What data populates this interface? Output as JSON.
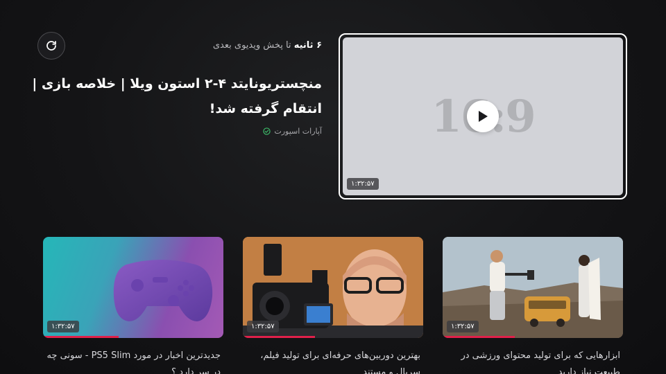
{
  "next": {
    "countdown_num": "۶ ثانیه",
    "countdown_rest": " تا پخش ویدیوی بعدی",
    "title": "منچستریونایتد ۴-۲ استون ویلا | خلاصه بازی | انتقام گرفته شد!",
    "channel": "آپارات اسپورت",
    "duration": "۱:۳۲:۵۷",
    "placeholder_text": "16:9"
  },
  "cards": [
    {
      "title": "ابزارهایی که برای تولید محتوای ورزشی در طبیعت نیاز دارید",
      "duration": "۱:۳۲:۵۷",
      "progress": 0.4
    },
    {
      "title": "بهترین دوربین‌های حرفه‌ای برای تولید فیلم، سریال و مستند",
      "duration": "۱:۳۲:۵۷",
      "progress": 0.4
    },
    {
      "title": "جدیدترین اخبار در مورد PS5 Slim - سونی چه در سر دارد ؟",
      "duration": "۱:۳۲:۵۷",
      "progress": 0.42
    }
  ],
  "icons": {
    "replay": "replay-icon",
    "play": "play-icon",
    "verified": "verified-check-icon"
  },
  "colors": {
    "progress": "#e0204a",
    "verified": "#3dbd6a"
  }
}
